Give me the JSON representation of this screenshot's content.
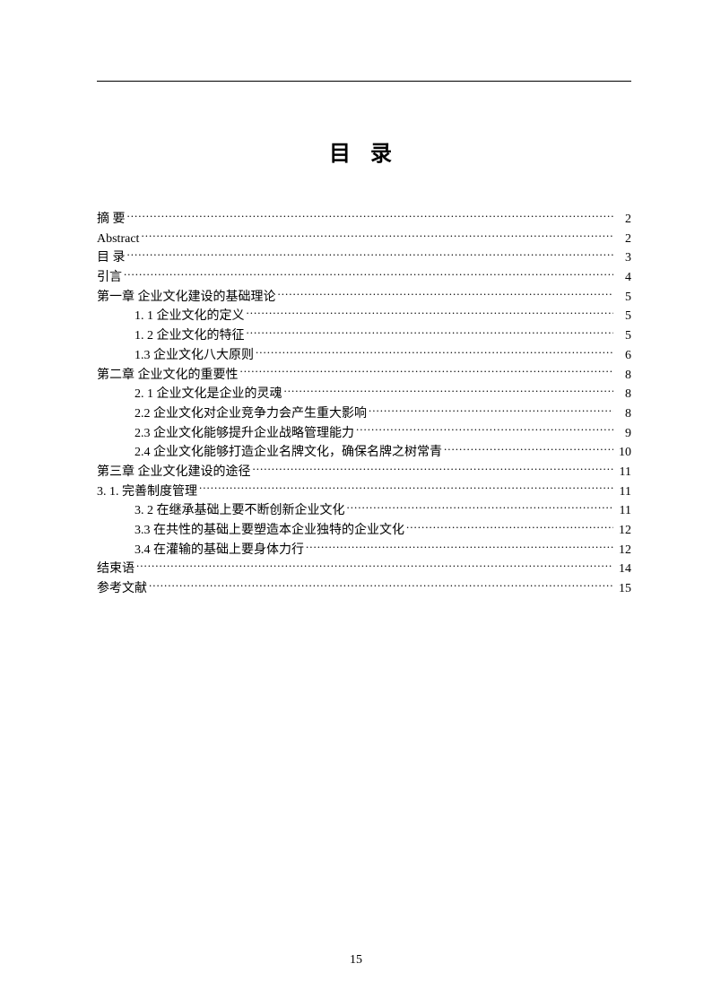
{
  "title": "目 录",
  "page_number": "15",
  "toc": [
    {
      "label": "摘 要",
      "page": "2",
      "indent": false
    },
    {
      "label": "Abstract",
      "page": "2",
      "indent": false
    },
    {
      "label": "目 录",
      "page": "3",
      "indent": false
    },
    {
      "label": "引言",
      "page": "4",
      "indent": false
    },
    {
      "label": "第一章 企业文化建设的基础理论",
      "page": "5",
      "indent": false
    },
    {
      "label": "1. 1 企业文化的定义",
      "page": "5",
      "indent": true
    },
    {
      "label": "1. 2 企业文化的特征",
      "page": "5",
      "indent": true
    },
    {
      "label": "1.3  企业文化八大原则",
      "page": "6",
      "indent": true
    },
    {
      "label": "第二章 企业文化的重要性",
      "page": "8",
      "indent": false
    },
    {
      "label": "2. 1 企业文化是企业的灵魂",
      "page": "8",
      "indent": true
    },
    {
      "label": "2.2  企业文化对企业竞争力会产生重大影响",
      "page": "8",
      "indent": true
    },
    {
      "label": "2.3  企业文化能够提升企业战略管理能力",
      "page": "9",
      "indent": true
    },
    {
      "label": "2.4  企业文化能够打造企业名牌文化，确保名牌之树常青",
      "page": "10",
      "indent": true
    },
    {
      "label": "第三章 企业文化建设的途径",
      "page": "11",
      "indent": false
    },
    {
      "label": "3. 1. 完善制度管理",
      "page": "11",
      "indent": false
    },
    {
      "label": "3. 2 在继承基础上要不断创新企业文化",
      "page": "11",
      "indent": true
    },
    {
      "label": "3.3  在共性的基础上要塑造本企业独特的企业文化",
      "page": "12",
      "indent": true
    },
    {
      "label": "3.4  在灌输的基础上要身体力行",
      "page": "12",
      "indent": true
    },
    {
      "label": "结束语",
      "page": "14",
      "indent": false
    },
    {
      "label": "参考文献",
      "page": "15",
      "indent": false
    }
  ]
}
